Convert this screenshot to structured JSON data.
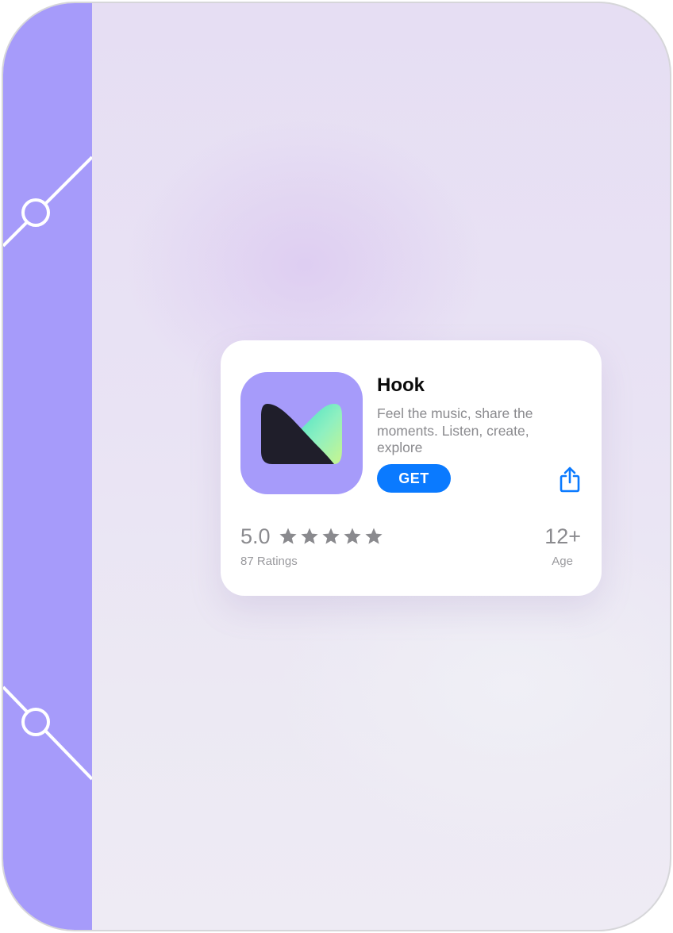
{
  "app": {
    "name": "Hook",
    "subtitle": "Feel the music, share the moments. Listen, create, explore",
    "get_label": "GET",
    "rating_value": "5.0",
    "rating_stars": 5,
    "ratings_count": "87 Ratings",
    "age_value": "12+",
    "age_label": "Age"
  },
  "icons": {
    "app_icon": "hook-logo-icon",
    "share": "share-icon",
    "star": "star-icon"
  },
  "colors": {
    "accent": "#0a7aff",
    "brand": "#a69bfa",
    "background": "#e8e2f3"
  }
}
